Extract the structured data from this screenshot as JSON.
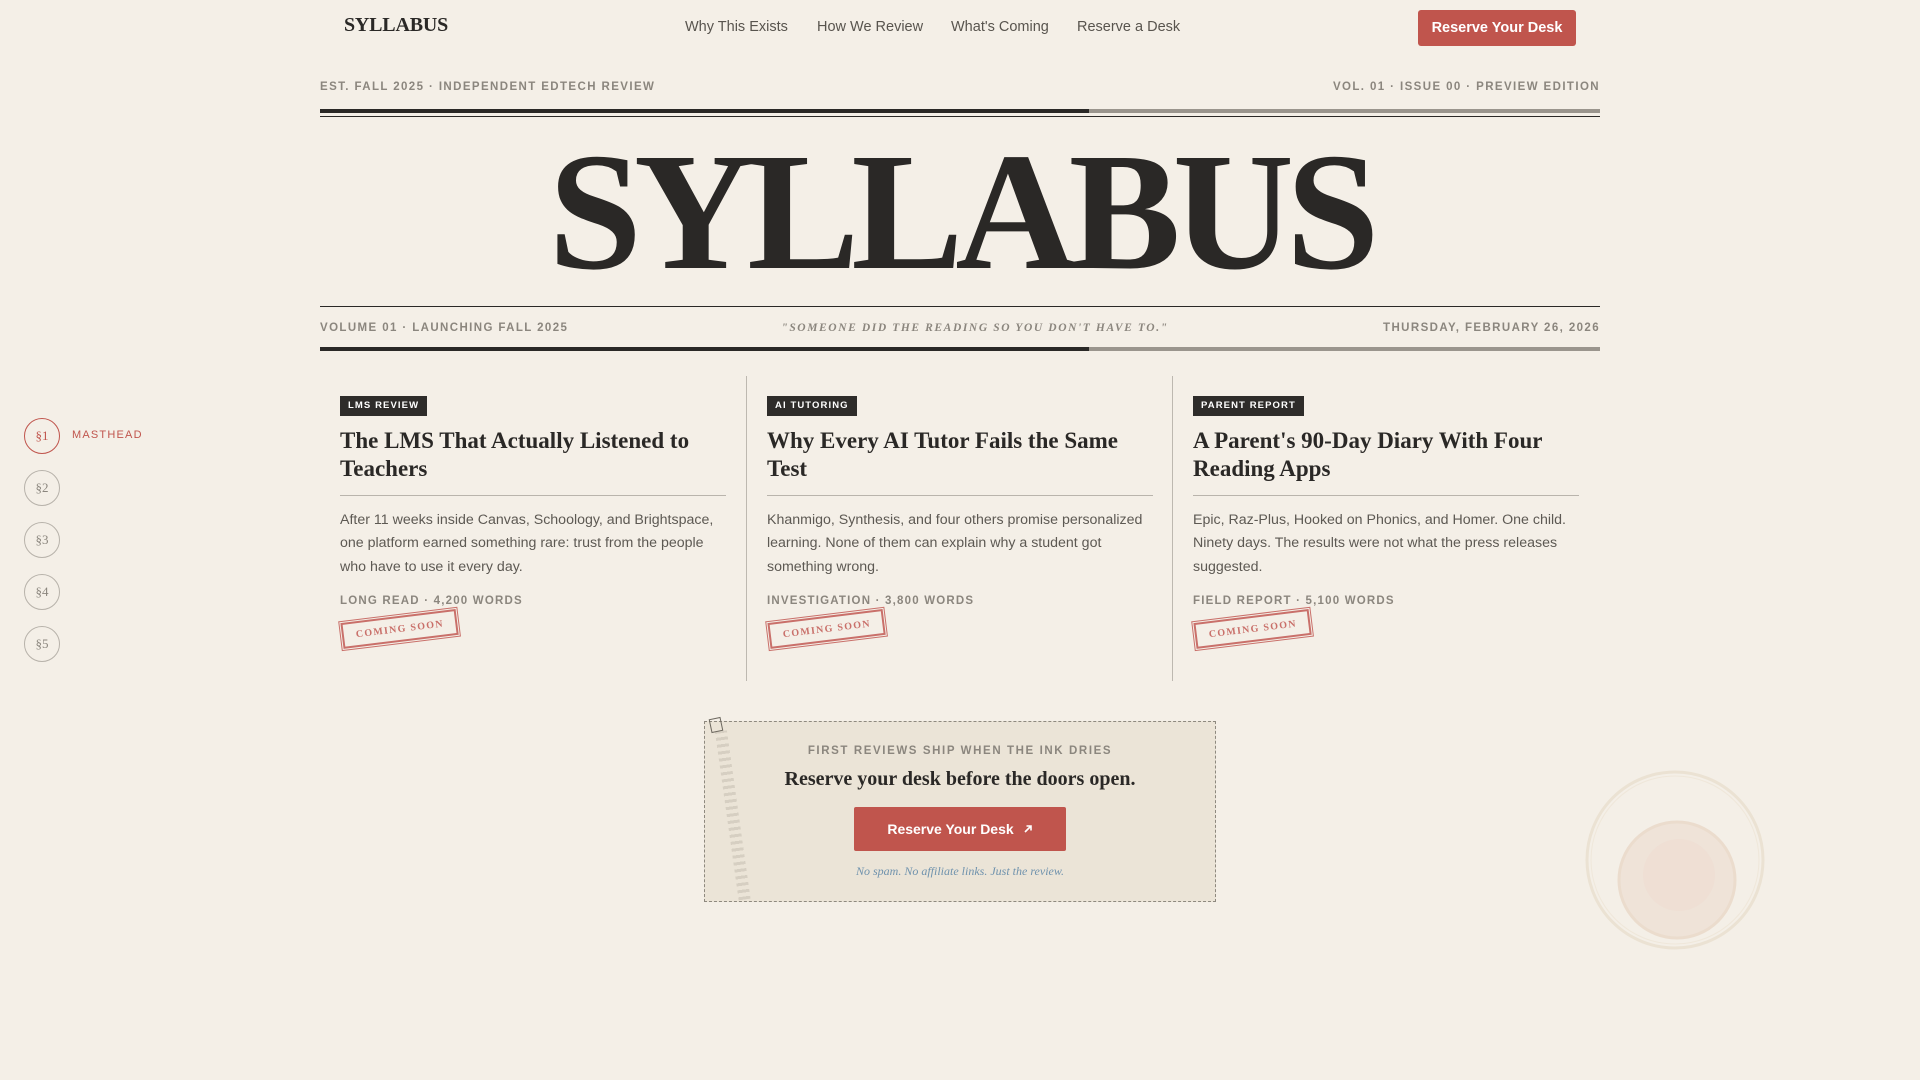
{
  "nav": {
    "brand": "SYLLABUS",
    "links": [
      "Why This Exists",
      "How We Review",
      "What's Coming",
      "Reserve a Desk"
    ],
    "cta_label": "Reserve Your Desk"
  },
  "header": {
    "left_kicker": "EST. FALL 2025 · INDEPENDENT EDTECH REVIEW",
    "right_kicker": "VOL. 01 · ISSUE 00 · PREVIEW EDITION",
    "masthead": "SYLLABUS",
    "volume": "VOLUME 01 · LAUNCHING FALL 2025",
    "motto": "\"Someone did the reading so you don't have to.\"",
    "date": "THURSDAY, FEBRUARY 26, 2026"
  },
  "rail": {
    "items": [
      "§1",
      "§2",
      "§3",
      "§4",
      "§5"
    ],
    "active_label": "MASTHEAD"
  },
  "articles": [
    {
      "tag": "LMS REVIEW",
      "headline": "The LMS That Actually Listened to Teachers",
      "dek": "After 11 weeks inside Canvas, Schoology, and Brightspace, one platform earned something rare: trust from the people who have to use it every day.",
      "meta": "LONG READ · 4,200 WORDS",
      "stamp": "COMING SOON"
    },
    {
      "tag": "AI TUTORING",
      "headline": "Why Every AI Tutor Fails the Same Test",
      "dek": "Khanmigo, Synthesis, and four others promise personalized learning. None of them can explain why a student got something wrong.",
      "meta": "INVESTIGATION · 3,800 WORDS",
      "stamp": "COMING SOON"
    },
    {
      "tag": "PARENT REPORT",
      "headline": "A Parent's 90-Day Diary With Four Reading Apps",
      "dek": "Epic, Raz-Plus, Hooked on Phonics, and Homer. One child. Ninety days. The results were not what the press releases suggested.",
      "meta": "FIELD REPORT · 5,100 WORDS",
      "stamp": "COMING SOON"
    }
  ],
  "cta": {
    "kicker": "FIRST REVIEWS SHIP WHEN THE INK DRIES",
    "title": "Reserve your desk before the doors open.",
    "button_label": "Reserve Your Desk",
    "button_icon": "arrow-up-right-icon",
    "note": "No spam. No affiliate links. Just the review."
  },
  "colors": {
    "background": "#f4efe7",
    "accent": "#c0554d",
    "ink": "#2a2826",
    "muted": "#8b867e",
    "note_blue": "#6f92ad"
  }
}
